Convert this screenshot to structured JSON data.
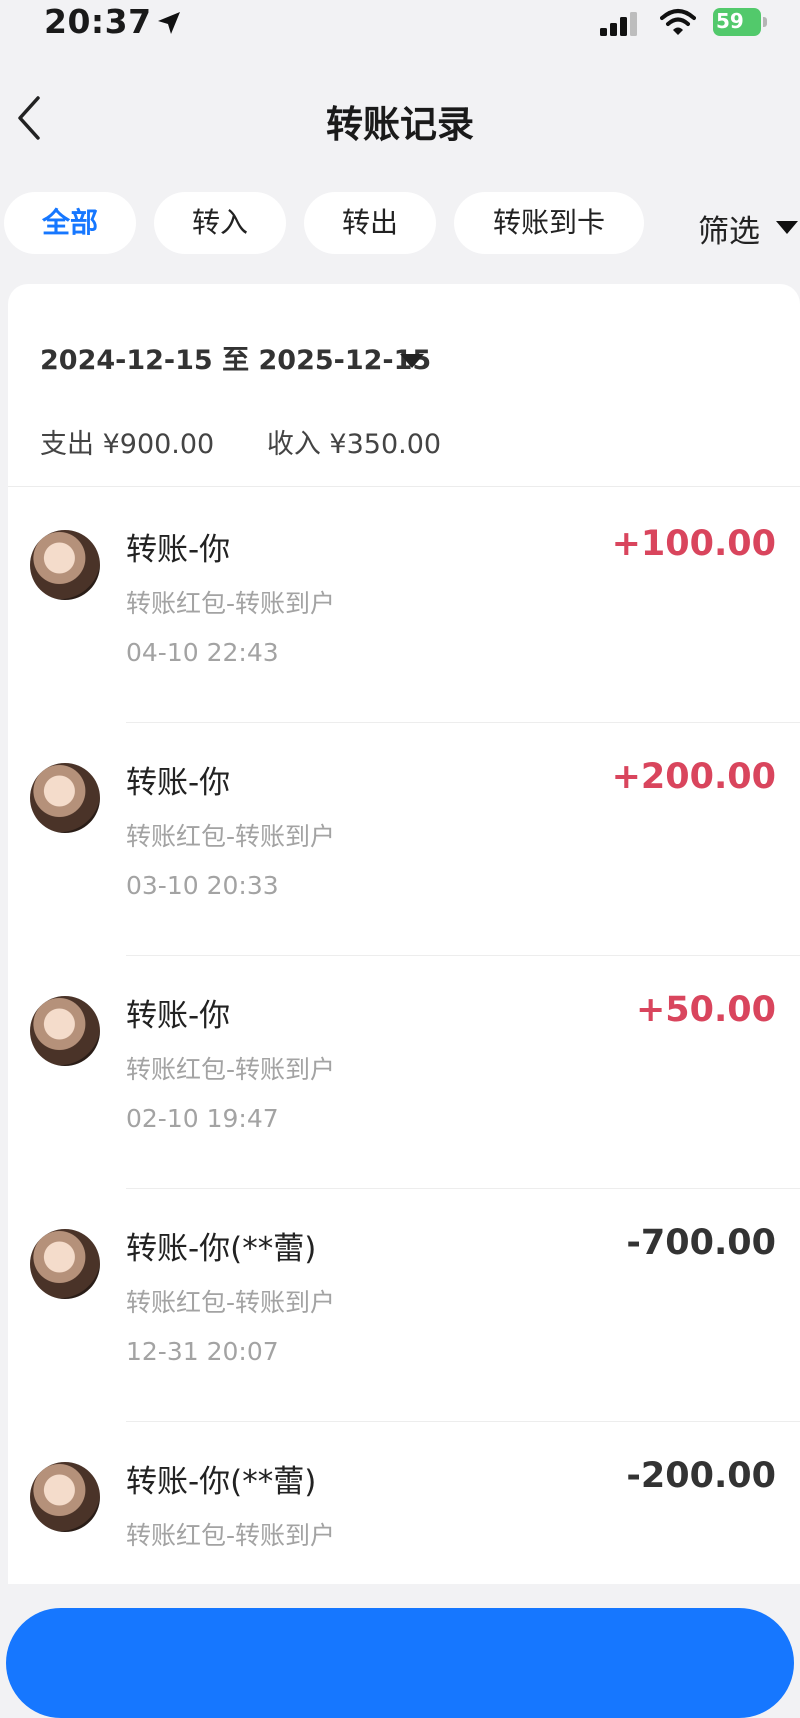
{
  "status_bar": {
    "time": "20:37",
    "battery": "59"
  },
  "header": {
    "title": "转账记录"
  },
  "tabs": [
    "全部",
    "转入",
    "转出",
    "转账到卡"
  ],
  "filter_label": "筛选",
  "summary": {
    "date_range": "2024-12-15 至 2025-12-15",
    "expense": "支出 ¥900.00",
    "income": "收入 ¥350.00"
  },
  "transactions": [
    {
      "name": "转账-你",
      "desc": "转账红包-转账到户",
      "time": "04-10 22:43",
      "amount": "+100.00",
      "type": "in"
    },
    {
      "name": "转账-你",
      "desc": "转账红包-转账到户",
      "time": "03-10 20:33",
      "amount": "+200.00",
      "type": "in"
    },
    {
      "name": "转账-你",
      "desc": "转账红包-转账到户",
      "time": "02-10 19:47",
      "amount": "+50.00",
      "type": "in"
    },
    {
      "name": "转账-你(**蕾)",
      "desc": "转账红包-转账到户",
      "time": "12-31 20:07",
      "amount": "-700.00",
      "type": "out"
    },
    {
      "name": "转账-你(**蕾)",
      "desc": "转账红包-转账到户",
      "time": "",
      "amount": "-200.00",
      "type": "out"
    }
  ],
  "colors": {
    "accent": "#1677ff",
    "income": "#d9455d",
    "battery": "#52c96b",
    "background": "#f2f2f4"
  }
}
